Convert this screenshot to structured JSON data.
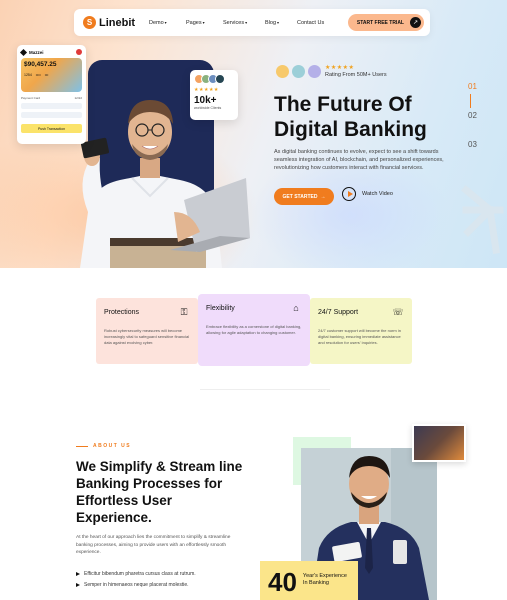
{
  "nav": {
    "logo_text": "Linebit",
    "items": [
      {
        "label": "Demo",
        "has_caret": true
      },
      {
        "label": "Pages",
        "has_caret": true
      },
      {
        "label": "Services",
        "has_caret": true
      },
      {
        "label": "Blog",
        "has_caret": true
      },
      {
        "label": "Contact Us",
        "has_caret": false
      }
    ],
    "cta_label": "START FREE TRIAL",
    "caret": "▾",
    "cta_icon": "arrow-icon"
  },
  "hero": {
    "bank_card": {
      "title": "Mazzei",
      "amount": "$90,457.25",
      "number_parts": [
        "1254",
        "••••",
        "•••"
      ],
      "row_label": "Payment Card",
      "row_value": "12/22",
      "button_label": "Push Transaction"
    },
    "clients_card": {
      "stars": "★★★★★",
      "count": "10k+",
      "label": "worldwide Clients"
    },
    "rating_stars": "★★★★★",
    "rating_text": "Rating From 50M+ Users",
    "title": "The Future Of Digital Banking",
    "description": "As digital banking continues to evolve, expect to see a shift towards seamless integration of AI, blockchain, and personalized experiences, revolutionizing how customers interact with financial services.",
    "cta_label": "GET STARTED",
    "cta_arrow": "→",
    "watch_label": "Watch Video",
    "slides": [
      "01",
      "02",
      "03"
    ],
    "active_slide": 0
  },
  "features": [
    {
      "title": "Protections",
      "icon": "shield-icon",
      "glyph": "⚿",
      "text": "Robust cybersecurity measures will become increasingly vital to safeguard sensitive financial data against evolving cyber."
    },
    {
      "title": "Flexibility",
      "icon": "building-icon",
      "glyph": "⌂",
      "text": "Embrace flexibility as a cornerstone of digital banking, allowing for agile adaptation to changing customer."
    },
    {
      "title": "24/7 Support",
      "icon": "support-icon",
      "glyph": "☏",
      "text": "24/7 customer support will become the norm in digital banking, ensuring immediate assistance and resolution for users' inquiries."
    }
  ],
  "about": {
    "tag": "ABOUT US",
    "title": "We Simplify & Stream line Banking Processes for Effortless User Experience.",
    "description": "At the heart of our approach lies the commitment to simplify & streamline banking processes, aiming to provide users with an effortlessly smooth experience.",
    "bullets": [
      "Efficitur bibendum pharetra cursus class at rutrum.",
      "Semper in himenaeos neque placerat molestie."
    ],
    "experience_number": "40",
    "experience_label": "Year's Experience In Banking"
  },
  "colors": {
    "accent": "#f07c1e",
    "cta_nav": "#fbb88d",
    "protections_bg": "#fde3dc",
    "flexibility_bg": "#f0dcfb",
    "support_bg": "#f5f6c6",
    "experience_bg": "#fbe58a"
  }
}
